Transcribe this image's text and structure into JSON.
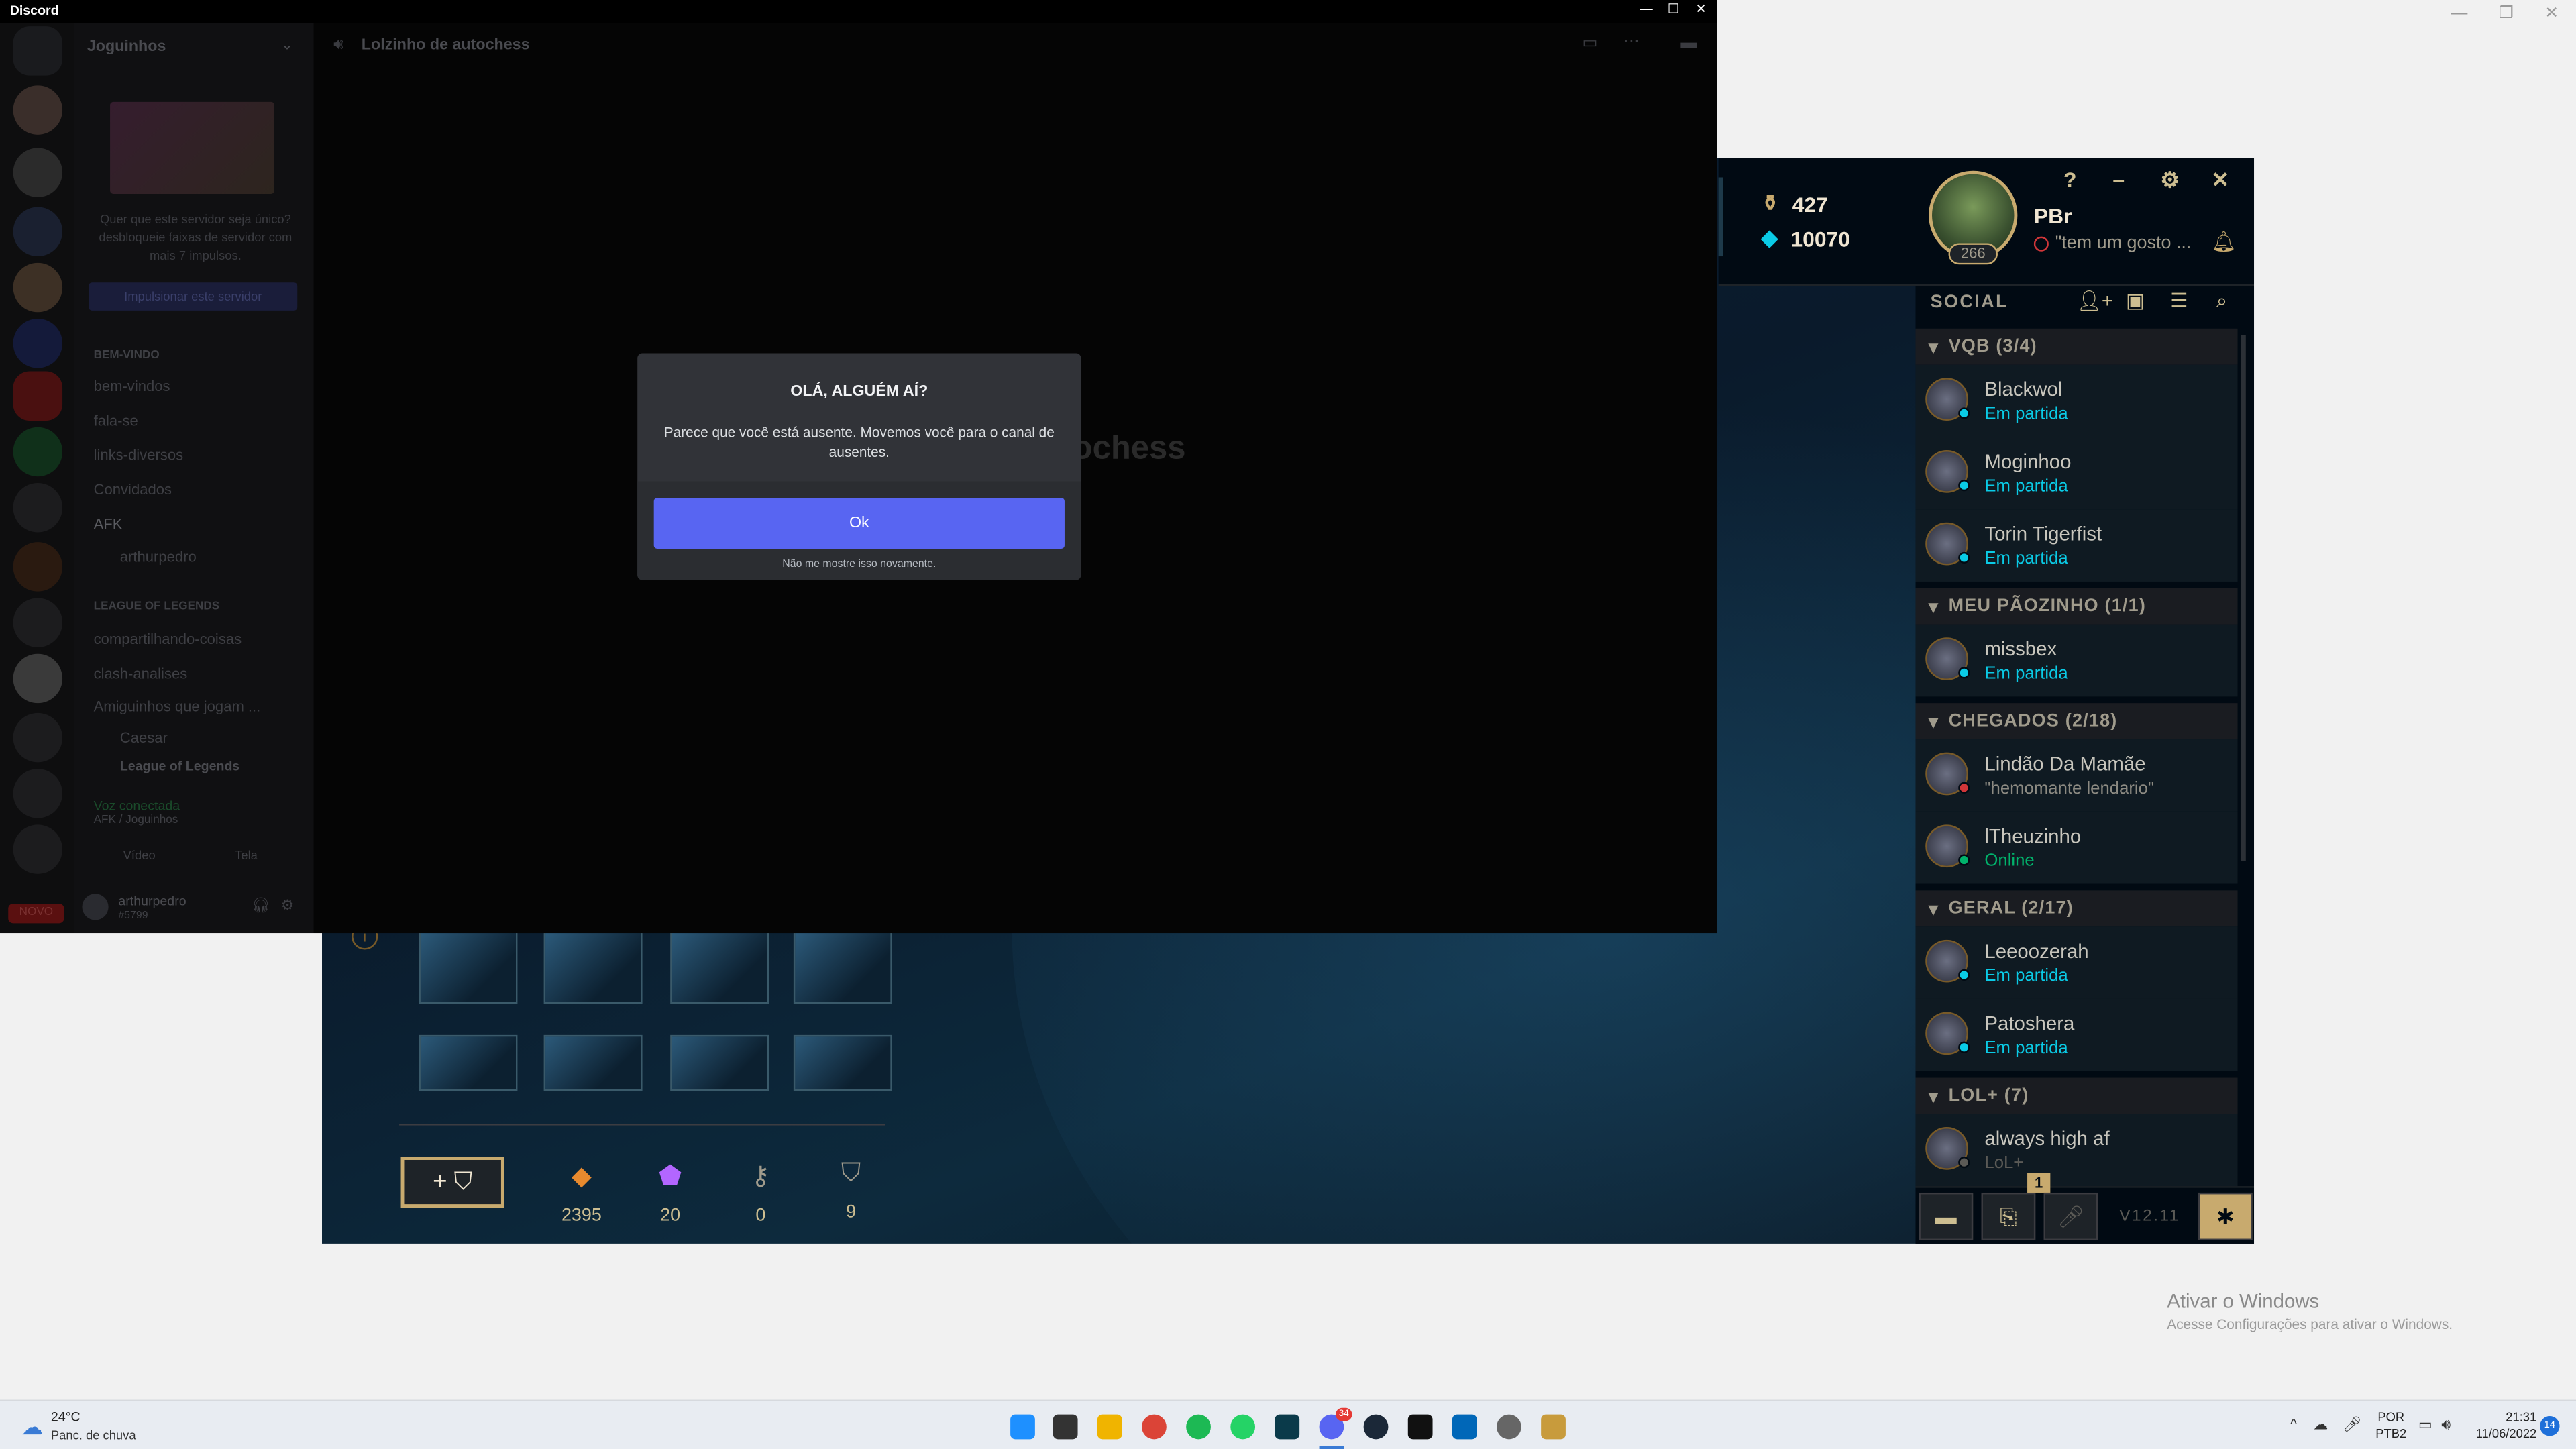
{
  "discord": {
    "app_title": "Discord",
    "server_name": "Joguinhos",
    "channel_header": "Lolzinho de autochess",
    "boost_text": "Quer que este servidor seja único? desbloqueie faixas de servidor com mais 7 impulsos.",
    "boost_button": "Impulsionar este servidor",
    "category_1": "BEM-VINDO",
    "channels_1": [
      "bem-vindos",
      "fala-se",
      "links-diversos",
      "Convidados",
      "AFK",
      "arthurpedro"
    ],
    "category_2": "LEAGUE OF LEGENDS",
    "channels_2": [
      "compartilhando-coisas",
      "clash-analises",
      "Amiguinhos que jogam ...",
      "Caesar"
    ],
    "now_playing": "League of Legends",
    "voice_status": "Voz conectada",
    "voice_channel": "AFK / Joguinhos",
    "video_label": "Vídeo",
    "screen_label": "Tela",
    "user_name": "arthurpedro",
    "user_sub": "#5799",
    "novo_badge": "NOVO",
    "bg_partial_title": "rochess",
    "modal": {
      "title": "OLÁ, ALGUÉM AÍ?",
      "body": "Parece que você está ausente. Movemos você para o canal de ausentes.",
      "ok_label": "Ok",
      "dont_show": "Não me mostre isso novamente."
    }
  },
  "lol": {
    "blue_essence_icon": "honor-icon",
    "currency_rp": "427",
    "currency_be": "10070",
    "player_name": "PBr",
    "player_status": "\"tem um gosto ...",
    "player_level": "266",
    "help_label": "?",
    "social_title": "SOCIAL",
    "groups": [
      {
        "name": "VQB (3/4)",
        "friends": [
          {
            "name": "Blackwol",
            "status": "Em partida"
          },
          {
            "name": "Moginhoo",
            "status": "Em partida"
          },
          {
            "name": "Torin Tigerfist",
            "status": "Em partida"
          }
        ]
      },
      {
        "name": "MEU PÃOZINHO (1/1)",
        "friends": [
          {
            "name": "missbex",
            "status": "Em partida"
          }
        ]
      },
      {
        "name": "CHEGADOS (2/18)",
        "friends": [
          {
            "name": "Lindão Da Mamãe",
            "status": "\"hemomante lendario\""
          },
          {
            "name": "lTheuzinho",
            "status": "Online"
          }
        ]
      },
      {
        "name": "GERAL (2/17)",
        "friends": [
          {
            "name": "Leeoozerah",
            "status": "Em partida"
          },
          {
            "name": "Patoshera",
            "status": "Em partida"
          }
        ]
      },
      {
        "name": "LOL+ (7)",
        "friends": [
          {
            "name": "always high af",
            "status": "LoL+"
          }
        ]
      }
    ],
    "notif_count": "1",
    "version": "V12.11",
    "loot_stats": [
      {
        "icon": "orange-essence-icon",
        "value": "2395"
      },
      {
        "icon": "mythic-essence-icon",
        "value": "20"
      },
      {
        "icon": "key-icon",
        "value": "0"
      },
      {
        "icon": "chest-icon",
        "value": "9"
      }
    ],
    "colors": {
      "gold": "#c8aa6e",
      "in_game": "#0acbe6",
      "online": "#0acbe6",
      "online_green": "#01b26b"
    }
  },
  "windows": {
    "watermark_title": "Ativar o Windows",
    "watermark_sub": "Acesse Configurações para ativar o Windows.",
    "weather_temp": "24°C",
    "weather_desc": "Panc. de chuva",
    "lang_1": "POR",
    "lang_2": "PTB2",
    "time": "21:31",
    "date": "11/06/2022",
    "notif_count": "14",
    "discord_badge": "34"
  }
}
